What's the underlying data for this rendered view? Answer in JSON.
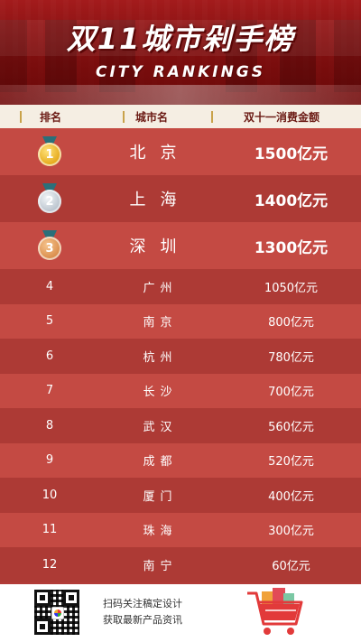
{
  "header": {
    "title": "双11城市剁手榜",
    "subtitle": "CITY RANKINGS"
  },
  "table": {
    "columns": [
      "排名",
      "城市名",
      "双十一消费金额"
    ],
    "rows": [
      {
        "rank": "1",
        "city": "北京",
        "amount": "1500亿元",
        "medal": "gold"
      },
      {
        "rank": "2",
        "city": "上海",
        "amount": "1400亿元",
        "medal": "silver"
      },
      {
        "rank": "3",
        "city": "深圳",
        "amount": "1300亿元",
        "medal": "bronze"
      },
      {
        "rank": "4",
        "city": "广州",
        "amount": "1050亿元"
      },
      {
        "rank": "5",
        "city": "南京",
        "amount": "800亿元"
      },
      {
        "rank": "6",
        "city": "杭州",
        "amount": "780亿元"
      },
      {
        "rank": "7",
        "city": "长沙",
        "amount": "700亿元"
      },
      {
        "rank": "8",
        "city": "武汉",
        "amount": "560亿元"
      },
      {
        "rank": "9",
        "city": "成都",
        "amount": "520亿元"
      },
      {
        "rank": "10",
        "city": "厦门",
        "amount": "400亿元"
      },
      {
        "rank": "11",
        "city": "珠海",
        "amount": "300亿元"
      },
      {
        "rank": "12",
        "city": "南宁",
        "amount": "60亿元"
      }
    ]
  },
  "footer": {
    "line1": "扫码关注稿定设计",
    "line2": "获取最新产品资讯",
    "qr_icon": "qr-code-icon",
    "cart_icon": "shopping-cart-icon"
  },
  "colors": {
    "accent": "#b23b38",
    "header_bar": "#f5eee3",
    "row_odd": "#c44a43",
    "row_even": "#ad3a35"
  }
}
